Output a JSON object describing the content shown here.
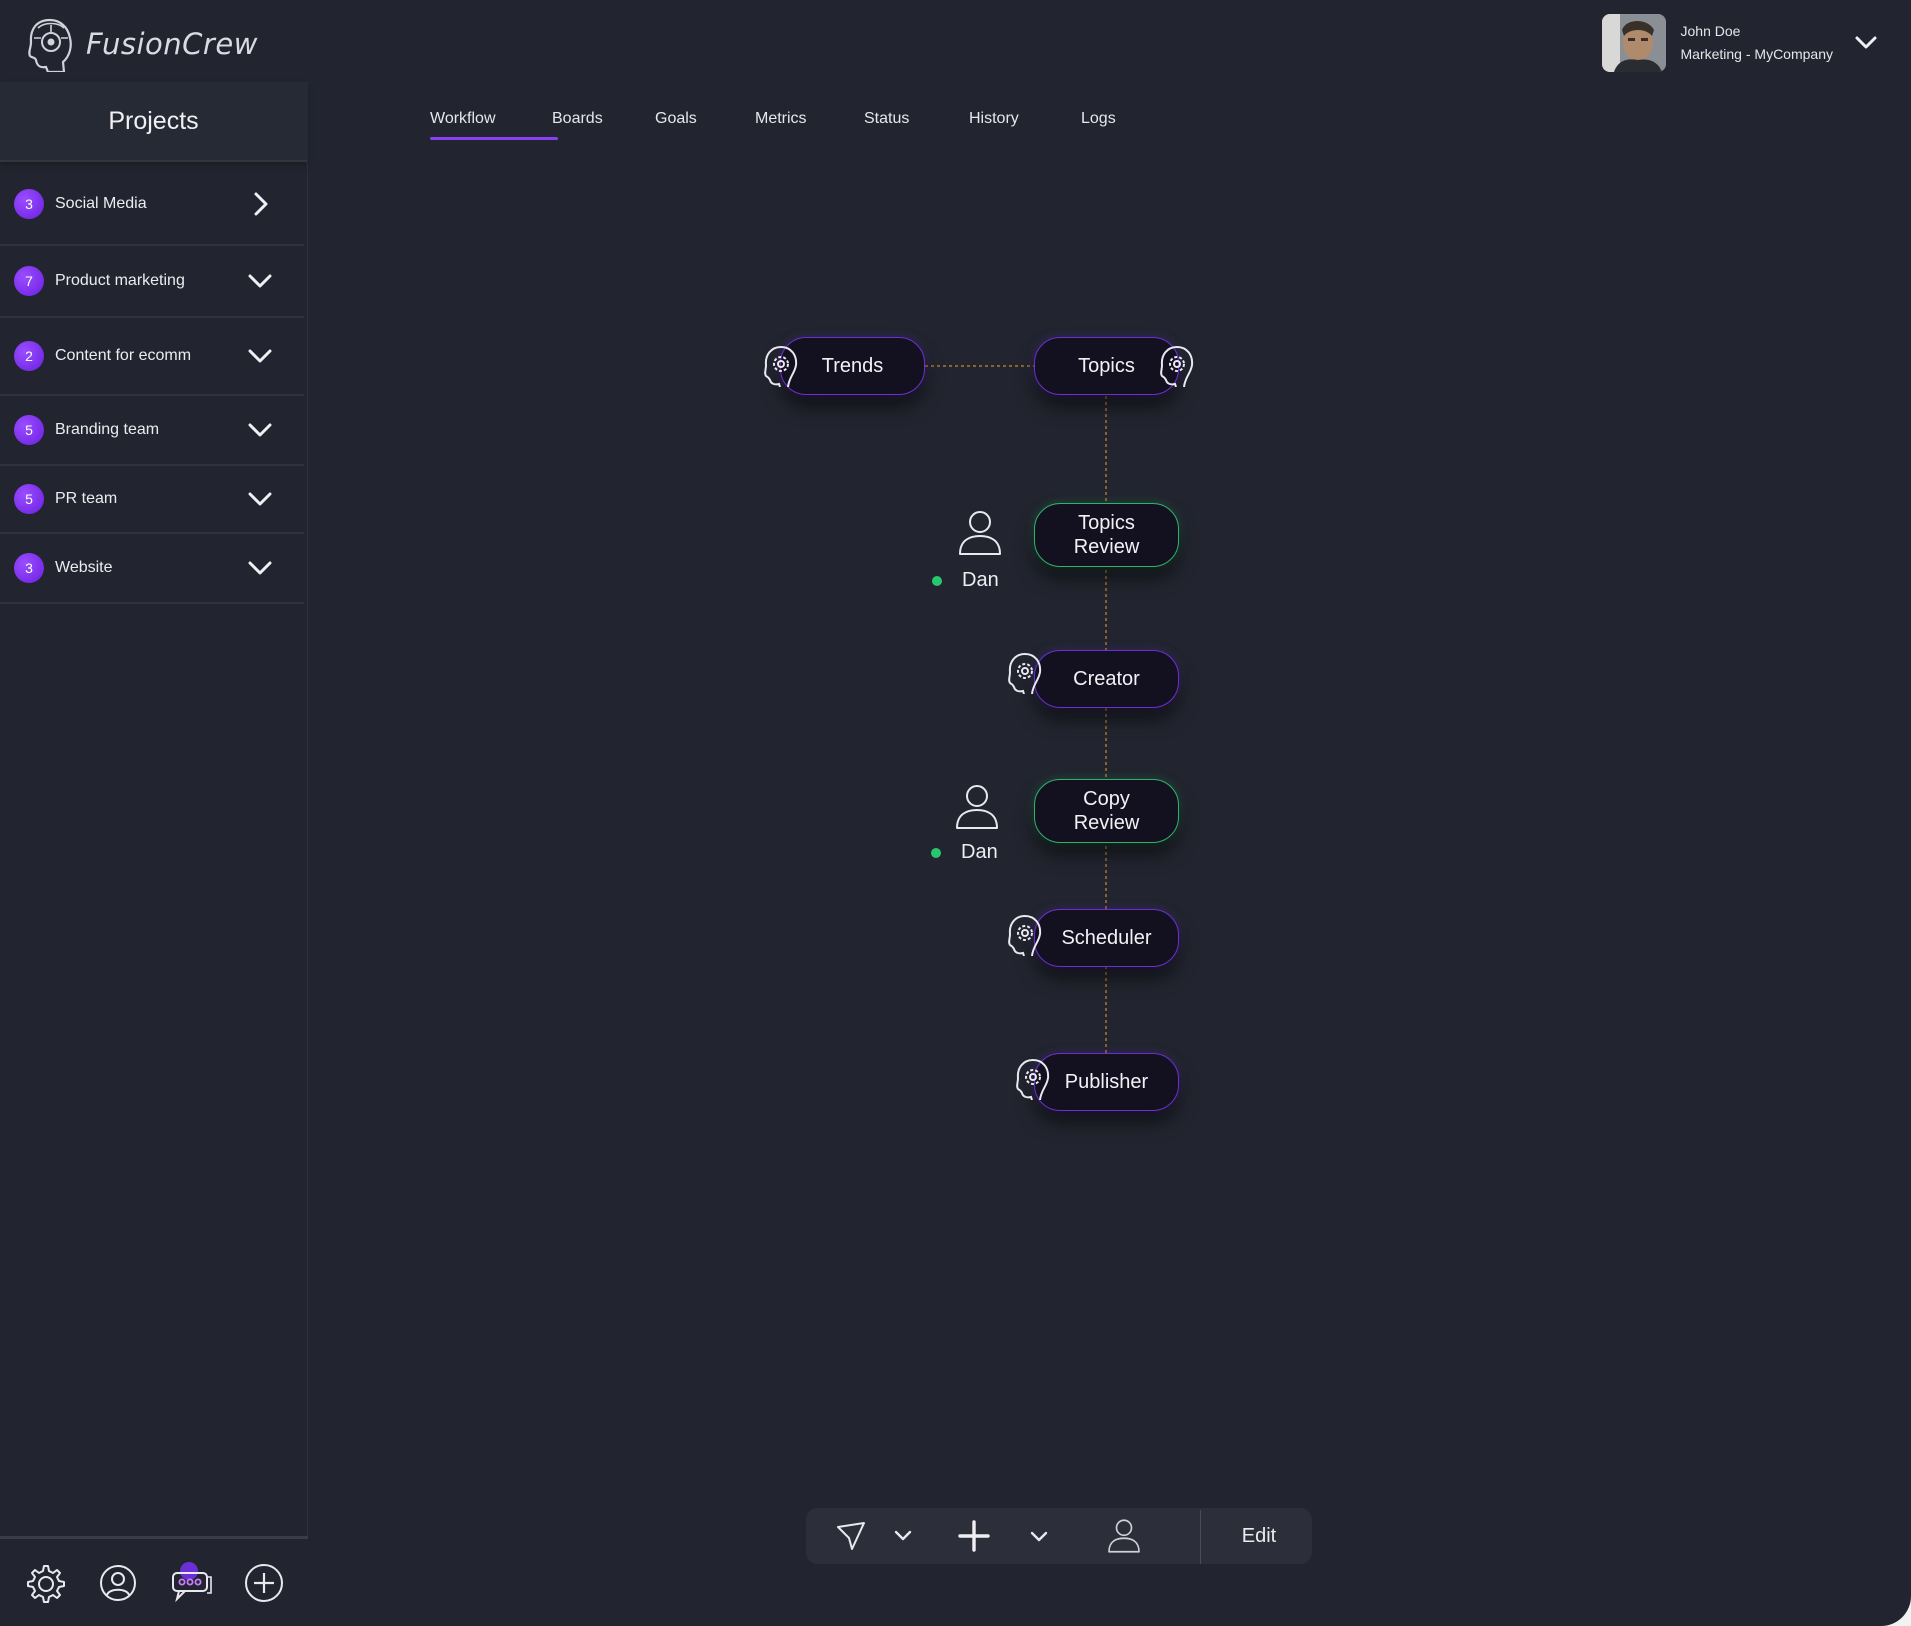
{
  "brand": {
    "name": "FusionCrew",
    "logo_icon": "robot-head-logo-icon"
  },
  "user": {
    "name": "John Doe",
    "role": "Marketing - MyCompany"
  },
  "sidebar": {
    "title": "Projects",
    "projects": [
      {
        "count": "3",
        "label": "Social Media",
        "state": "expanded-right"
      },
      {
        "count": "7",
        "label": "Product marketing",
        "state": "collapsed"
      },
      {
        "count": "2",
        "label": "Content for ecomm",
        "state": "collapsed"
      },
      {
        "count": "5",
        "label": "Branding team",
        "state": "collapsed"
      },
      {
        "count": "5",
        "label": "PR team",
        "state": "collapsed"
      },
      {
        "count": "3",
        "label": "Website",
        "state": "collapsed"
      }
    ],
    "bottom_icons": [
      "settings-icon",
      "profile-icon",
      "chat-icon",
      "add-circle-icon"
    ]
  },
  "tabs": [
    {
      "label": "Workflow",
      "active": true
    },
    {
      "label": "Boards",
      "active": false
    },
    {
      "label": "Goals",
      "active": false
    },
    {
      "label": "Metrics",
      "active": false
    },
    {
      "label": "Status",
      "active": false
    },
    {
      "label": "History",
      "active": false
    },
    {
      "label": "Logs",
      "active": false
    }
  ],
  "workflow": {
    "nodes": [
      {
        "id": "trends",
        "label": "Trends",
        "type": "agent"
      },
      {
        "id": "topics",
        "label": "Topics",
        "type": "agent"
      },
      {
        "id": "topics_review",
        "label_line1": "Topics",
        "label_line2": "Review",
        "type": "human",
        "assignee": "Dan",
        "assignee_status": "online"
      },
      {
        "id": "creator",
        "label": "Creator",
        "type": "agent"
      },
      {
        "id": "copy_review",
        "label_line1": "Copy",
        "label_line2": "Review",
        "type": "human",
        "assignee": "Dan",
        "assignee_status": "online"
      },
      {
        "id": "scheduler",
        "label": "Scheduler",
        "type": "agent"
      },
      {
        "id": "publisher",
        "label": "Publisher",
        "type": "agent"
      }
    ],
    "connector_color": "#c98a2e",
    "agent_border_color": "#6a2fd6",
    "human_border_color": "#2fb36a"
  },
  "toolbar": {
    "tools": [
      "pointer-icon",
      "chevron-down-icon",
      "plus-icon",
      "chevron-down-icon",
      "user-icon"
    ],
    "edit_label": "Edit"
  },
  "colors": {
    "background": "#22252f",
    "accent": "#8a3ff2",
    "online": "#28c76f"
  }
}
